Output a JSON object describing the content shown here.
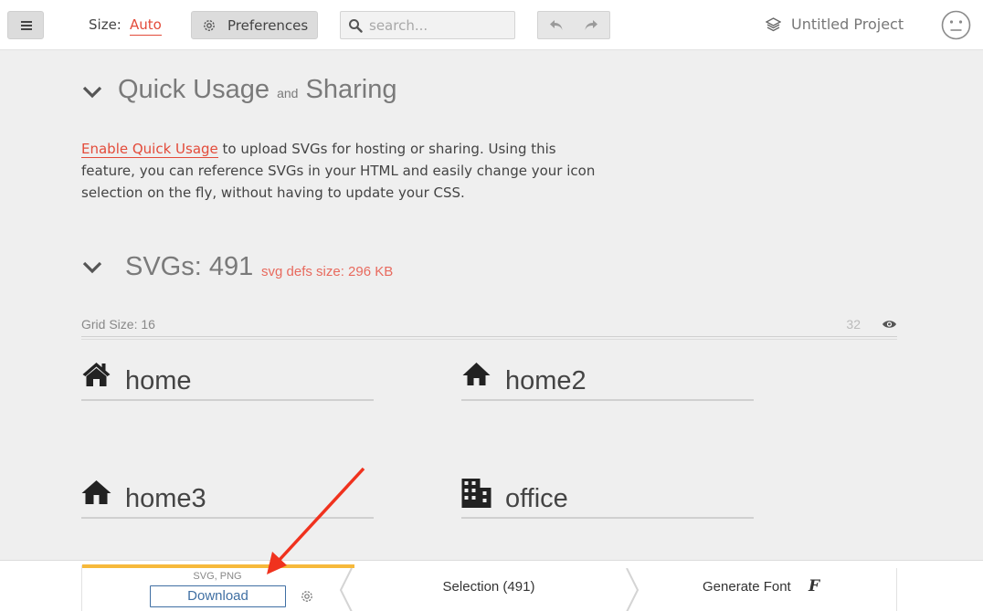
{
  "topbar": {
    "size_label": "Size:",
    "size_value": "Auto",
    "preferences_label": "Preferences",
    "search_placeholder": "search...",
    "project_name": "Untitled Project"
  },
  "quick_usage": {
    "title_part1": "Quick Usage",
    "title_and": "and",
    "title_part2": "Sharing",
    "link_text": "Enable Quick Usage",
    "body_text": " to upload SVGs for hosting or sharing. Using this feature, you can reference SVGs in your HTML and easily change your icon selection on the fly, without having to update your CSS."
  },
  "svgs": {
    "title": "SVGs: 491",
    "defs_size": "svg defs size: 296 KB",
    "grid_label": "Grid Size: 16",
    "grid_value": "32"
  },
  "glyphs": [
    {
      "name": "home",
      "icon": "home-icon"
    },
    {
      "name": "home2",
      "icon": "home2-icon"
    },
    {
      "name": "home3",
      "icon": "home3-icon"
    },
    {
      "name": "office",
      "icon": "office-icon"
    }
  ],
  "bottombar": {
    "formats": "SVG, PNG",
    "download_label": "Download",
    "selection_label": "Selection (491)",
    "generate_font_label": "Generate Font",
    "font_glyph": "F"
  },
  "colors": {
    "accent_red": "#e34b3a",
    "download_blue": "#3f6fa3",
    "active_tab_orange": "#f6b93b",
    "annotation_arrow": "#f0321e"
  }
}
